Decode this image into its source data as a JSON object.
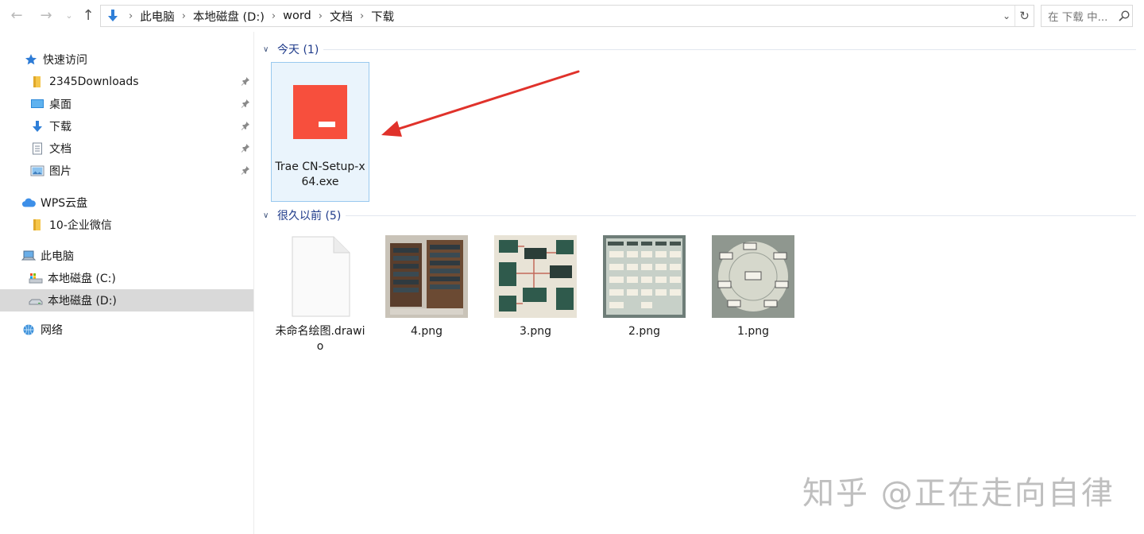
{
  "address_bar": {
    "breadcrumb": [
      "此电脑",
      "本地磁盘 (D:)",
      "word",
      "文档",
      "下载"
    ]
  },
  "search": {
    "placeholder": "在 下载 中..."
  },
  "sidebar": {
    "quick_access": "快速访问",
    "quick_items": [
      {
        "label": "2345Downloads",
        "icon": "folder-icon"
      },
      {
        "label": "桌面",
        "icon": "desktop-icon"
      },
      {
        "label": "下载",
        "icon": "download-icon"
      },
      {
        "label": "文档",
        "icon": "document-icon"
      },
      {
        "label": "图片",
        "icon": "pictures-icon"
      }
    ],
    "wps_cloud": "WPS云盘",
    "wps_items": [
      {
        "label": "10-企业微信",
        "icon": "folder-icon"
      }
    ],
    "this_pc": "此电脑",
    "pc_items": [
      {
        "label": "本地磁盘 (C:)",
        "icon": "drive-c-icon"
      },
      {
        "label": "本地磁盘 (D:)",
        "icon": "drive-icon",
        "selected": true
      }
    ],
    "network": "网络"
  },
  "content": {
    "groups": [
      {
        "header": "今天 (1)",
        "files": [
          {
            "name": "Trae CN-Setup-x64.exe",
            "icon": "trae-exe-icon",
            "selected": true
          }
        ]
      },
      {
        "header": "很久以前 (5)",
        "files": [
          {
            "name": "未命名绘图.drawio",
            "icon": "blank-file-icon"
          },
          {
            "name": "4.png",
            "icon": "image-thumbnail"
          },
          {
            "name": "3.png",
            "icon": "image-thumbnail"
          },
          {
            "name": "2.png",
            "icon": "image-thumbnail"
          },
          {
            "name": "1.png",
            "icon": "image-thumbnail"
          }
        ]
      }
    ]
  },
  "watermark": "知乎 @正在走向自律",
  "colors": {
    "accent": "#1e3a8a",
    "selection": "#d9d9d9",
    "tile_selected_bg": "#eaf4fc",
    "trae_red": "#f74f3d",
    "arrow": "#e0322b"
  }
}
